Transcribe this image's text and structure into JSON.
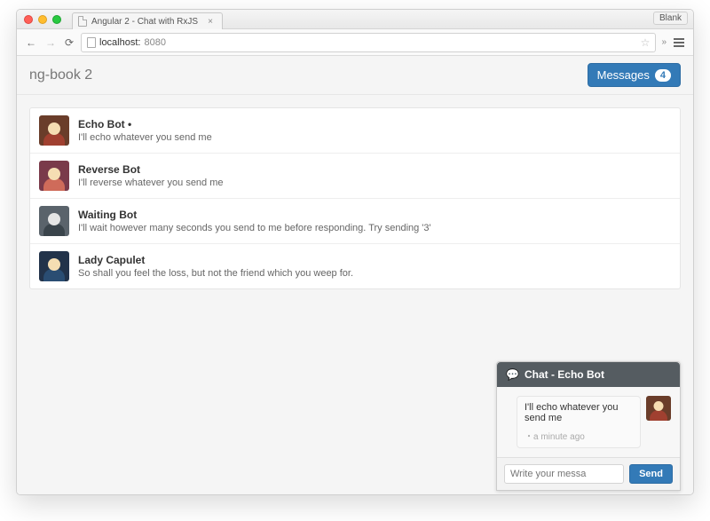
{
  "browser": {
    "tab_title": "Angular 2 - Chat with RxJS",
    "blank_label": "Blank",
    "url_host": "localhost:",
    "url_port": "8080"
  },
  "header": {
    "brand": "ng-book 2",
    "messages_label": "Messages",
    "messages_count": "4"
  },
  "threads": [
    {
      "name": "Echo Bot •",
      "message": "I'll echo whatever you send me",
      "avatar_class": "av-echo"
    },
    {
      "name": "Reverse Bot",
      "message": "I'll reverse whatever you send me",
      "avatar_class": "av-rev"
    },
    {
      "name": "Waiting Bot",
      "message": "I'll wait however many seconds you send to me before responding. Try sending '3'",
      "avatar_class": "av-wait"
    },
    {
      "name": "Lady Capulet",
      "message": "So shall you feel the loss, but not the friend which you weep for.",
      "avatar_class": "av-lady"
    }
  ],
  "chat": {
    "title": "Chat - Echo Bot",
    "message_text": "I'll echo whatever you send me",
    "message_time": "・a minute ago",
    "input_placeholder": "Write your messa",
    "send_label": "Send"
  }
}
